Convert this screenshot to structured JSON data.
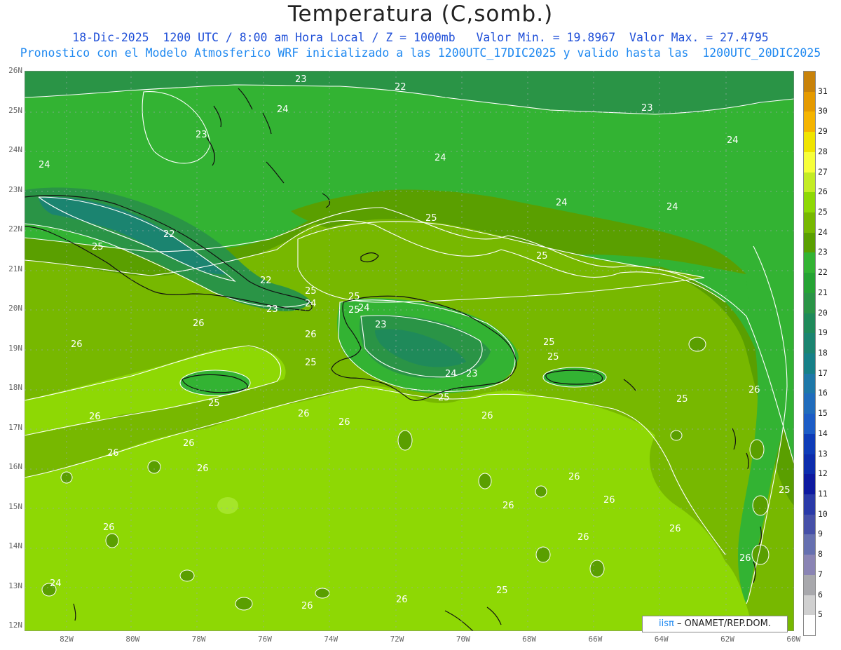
{
  "header": {
    "title": "Temperatura (C,somb.)",
    "line1": "18-Dic-2025  1200 UTC / 8:00 am Hora Local / Z = 1000mb   Valor Min. = 19.8967  Valor Max. = 27.4795",
    "line2": "Pronostico con el Modelo Atmosferico WRF inicializado a las 1200UTC_17DIC2025 y valido hasta las  1200UTC_20DIC2025"
  },
  "map": {
    "lat_labels": [
      "26N",
      "25N",
      "24N",
      "23N",
      "22N",
      "21N",
      "20N",
      "19N",
      "18N",
      "17N",
      "16N",
      "15N",
      "14N",
      "13N",
      "12N"
    ],
    "lon_labels": [
      "82W",
      "80W",
      "78W",
      "76W",
      "74W",
      "72W",
      "70W",
      "68W",
      "66W",
      "64W",
      "62W",
      "60W"
    ],
    "contour_labels": [
      {
        "text": "23"
      },
      {
        "text": "22"
      },
      {
        "text": "24"
      },
      {
        "text": "23"
      },
      {
        "text": "23"
      },
      {
        "text": "24"
      },
      {
        "text": "24"
      },
      {
        "text": "24"
      },
      {
        "text": "24"
      },
      {
        "text": "24"
      },
      {
        "text": "22"
      },
      {
        "text": "25"
      },
      {
        "text": "25"
      },
      {
        "text": "25"
      },
      {
        "text": "22"
      },
      {
        "text": "25"
      },
      {
        "text": "24"
      },
      {
        "text": "23"
      },
      {
        "text": "25"
      },
      {
        "text": "25"
      },
      {
        "text": "24"
      },
      {
        "text": "26"
      },
      {
        "text": "26"
      },
      {
        "text": "26"
      },
      {
        "text": "25"
      },
      {
        "text": "25"
      },
      {
        "text": "23"
      },
      {
        "text": "24"
      },
      {
        "text": "23"
      },
      {
        "text": "25"
      },
      {
        "text": "25"
      },
      {
        "text": "25"
      },
      {
        "text": "26"
      },
      {
        "text": "26"
      },
      {
        "text": "26"
      },
      {
        "text": "26"
      },
      {
        "text": "26"
      },
      {
        "text": "26"
      },
      {
        "text": "26"
      },
      {
        "text": "26"
      },
      {
        "text": "26"
      },
      {
        "text": "26"
      },
      {
        "text": "26"
      },
      {
        "text": "26"
      },
      {
        "text": "26"
      },
      {
        "text": "26"
      },
      {
        "text": "26"
      },
      {
        "text": "26"
      },
      {
        "text": "25"
      },
      {
        "text": "26"
      },
      {
        "text": "25"
      },
      {
        "text": "25"
      },
      {
        "text": "24"
      }
    ]
  },
  "colorbar": {
    "labels": [
      "31",
      "30",
      "29",
      "28",
      "27",
      "26",
      "25",
      "24",
      "23",
      "22",
      "21",
      "20",
      "19",
      "18",
      "17",
      "16",
      "15",
      "14",
      "13",
      "12",
      "11",
      "10",
      "9",
      "8",
      "7",
      "6",
      "5"
    ],
    "colors": [
      "#c8820a",
      "#e59a00",
      "#f5b400",
      "#f0e400",
      "#f7ff3a",
      "#c4ec24",
      "#8ed804",
      "#77b800",
      "#5a9f00",
      "#33b333",
      "#26a334",
      "#2a9446",
      "#1f8a5a",
      "#1b8470",
      "#168088",
      "#1e78a8",
      "#206cbc",
      "#1c5cc6",
      "#0e3cb8",
      "#0d2dad",
      "#0e1aa0",
      "#2a3aa8",
      "#4650a8",
      "#6670b0",
      "#8a84b4",
      "#a8a8ac",
      "#d0d0d0",
      "#ffffff"
    ]
  },
  "credit": {
    "logo": "iisπ",
    "text": "– ONAMET/REP.DOM."
  }
}
